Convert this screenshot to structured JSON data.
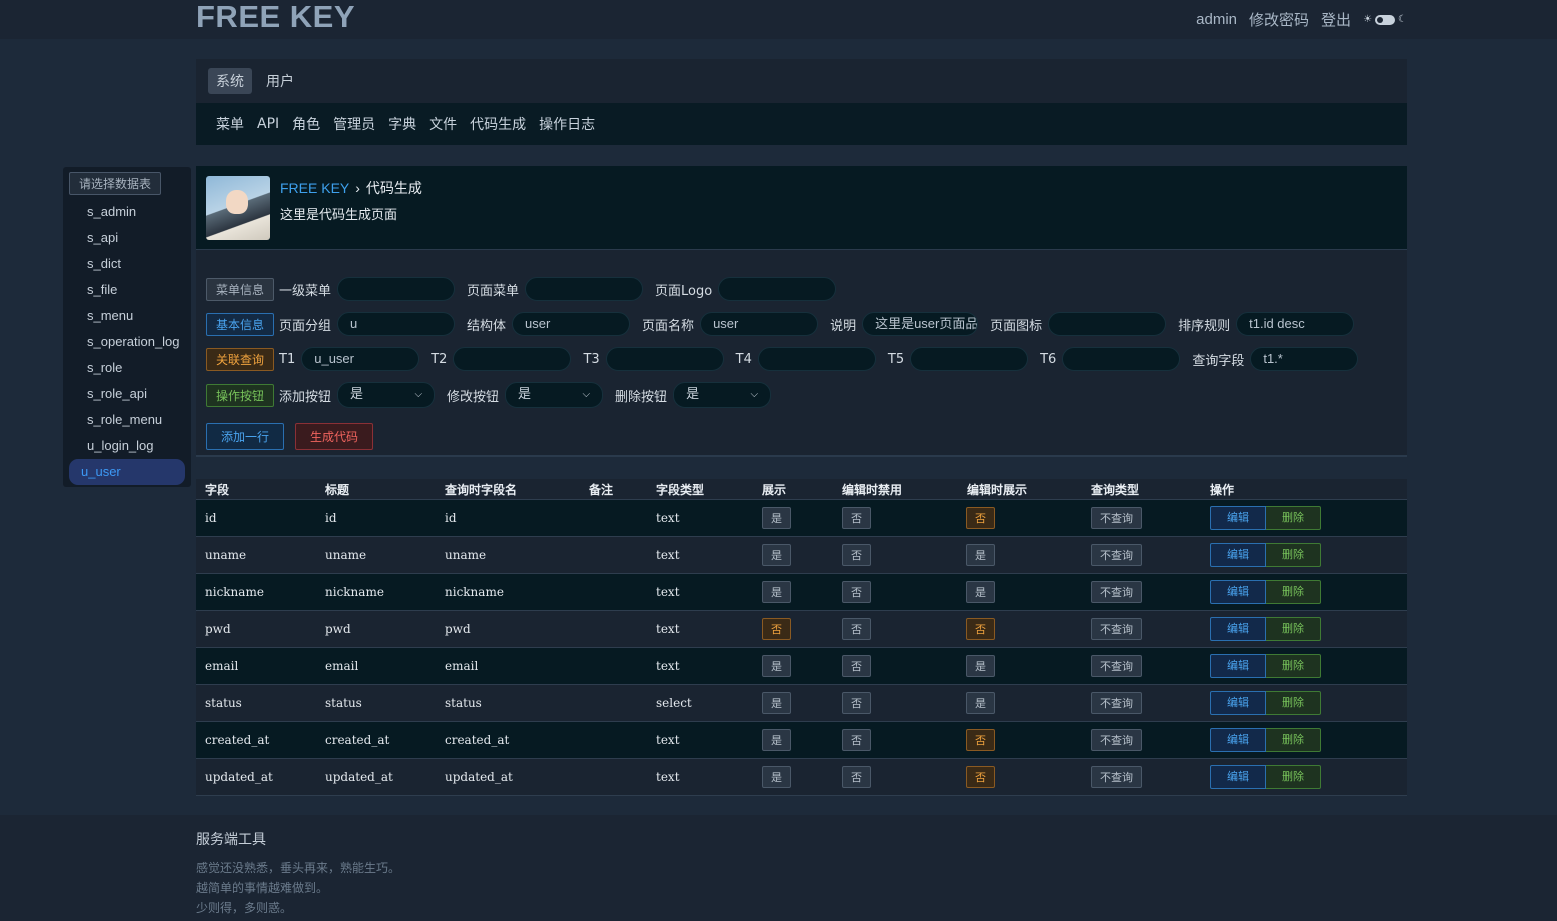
{
  "header": {
    "logo": "FREE KEY",
    "user": "admin",
    "change_pwd": "修改密码",
    "logout": "登出",
    "theme_sun": "☀",
    "theme_moon": "☾"
  },
  "nav": {
    "tabs": [
      {
        "label": "系统",
        "active": true
      },
      {
        "label": "用户",
        "active": false
      }
    ],
    "sub": [
      "菜单",
      "API",
      "角色",
      "管理员",
      "字典",
      "文件",
      "代码生成",
      "操作日志"
    ]
  },
  "sidebar": {
    "header": "请选择数据表",
    "items": [
      "s_admin",
      "s_api",
      "s_dict",
      "s_file",
      "s_menu",
      "s_operation_log",
      "s_role",
      "s_role_api",
      "s_role_menu",
      "u_login_log",
      "u_user"
    ],
    "active": "u_user"
  },
  "page": {
    "crumb_home": "FREE KEY",
    "crumb_sep": "›",
    "crumb_current": "代码生成",
    "desc": "这里是代码生成页面"
  },
  "form": {
    "menu_info": {
      "tag": "菜单信息",
      "first_menu_label": "一级菜单",
      "first_menu": "",
      "page_menu_label": "页面菜单",
      "page_menu": "",
      "page_logo_label": "页面Logo",
      "page_logo": ""
    },
    "basic_info": {
      "tag": "基本信息",
      "group_label": "页面分组",
      "group": "u",
      "struct_label": "结构体",
      "struct": "user",
      "name_label": "页面名称",
      "name": "user",
      "desc_label": "说明",
      "desc": "这里是user页面品",
      "icon_label": "页面图标",
      "icon": "",
      "order_label": "排序规则",
      "order": "t1.id desc"
    },
    "join": {
      "tag": "关联查询",
      "t1_label": "T1",
      "t1": "u_user",
      "t2_label": "T2",
      "t2": "",
      "t3_label": "T3",
      "t3": "",
      "t4_label": "T4",
      "t4": "",
      "t5_label": "T5",
      "t5": "",
      "t6_label": "T6",
      "t6": "",
      "fields_label": "查询字段",
      "fields": "t1.*"
    },
    "buttons": {
      "tag": "操作按钮",
      "add_label": "添加按钮",
      "add": "是",
      "edit_label": "修改按钮",
      "edit": "是",
      "del_label": "删除按钮",
      "del": "是"
    },
    "add_row": "添加一行",
    "generate": "生成代码"
  },
  "table": {
    "headers": [
      "字段",
      "标题",
      "查询时字段名",
      "备注",
      "字段类型",
      "展示",
      "编辑时禁用",
      "编辑时展示",
      "查询类型",
      "操作"
    ],
    "edit_label": "编辑",
    "delete_label": "删除",
    "rows": [
      {
        "field": "id",
        "title": "id",
        "query": "id",
        "note": "",
        "type": "text",
        "show": "是",
        "disabled": "否",
        "edit_show": "否",
        "query_type": "不查询"
      },
      {
        "field": "uname",
        "title": "uname",
        "query": "uname",
        "note": "",
        "type": "text",
        "show": "是",
        "disabled": "否",
        "edit_show": "是",
        "query_type": "不查询"
      },
      {
        "field": "nickname",
        "title": "nickname",
        "query": "nickname",
        "note": "",
        "type": "text",
        "show": "是",
        "disabled": "否",
        "edit_show": "是",
        "query_type": "不查询"
      },
      {
        "field": "pwd",
        "title": "pwd",
        "query": "pwd",
        "note": "",
        "type": "text",
        "show": "否",
        "disabled": "否",
        "edit_show": "否",
        "query_type": "不查询"
      },
      {
        "field": "email",
        "title": "email",
        "query": "email",
        "note": "",
        "type": "text",
        "show": "是",
        "disabled": "否",
        "edit_show": "是",
        "query_type": "不查询"
      },
      {
        "field": "status",
        "title": "status",
        "query": "status",
        "note": "",
        "type": "select",
        "show": "是",
        "disabled": "否",
        "edit_show": "是",
        "query_type": "不查询"
      },
      {
        "field": "created_at",
        "title": "created_at",
        "query": "created_at",
        "note": "",
        "type": "text",
        "show": "是",
        "disabled": "否",
        "edit_show": "否",
        "query_type": "不查询"
      },
      {
        "field": "updated_at",
        "title": "updated_at",
        "query": "updated_at",
        "note": "",
        "type": "text",
        "show": "是",
        "disabled": "否",
        "edit_show": "否",
        "query_type": "不查询"
      }
    ]
  },
  "footer": {
    "title": "服务端工具",
    "lines": [
      "感觉还没熟悉，垂头再来，熟能生巧。",
      "越简单的事情越难做到。",
      "少则得，多则惑。"
    ]
  },
  "colors": {
    "accent": "#3ea0ec",
    "warn": "#efa23e",
    "danger": "#f0645e",
    "success": "#77c25a"
  }
}
